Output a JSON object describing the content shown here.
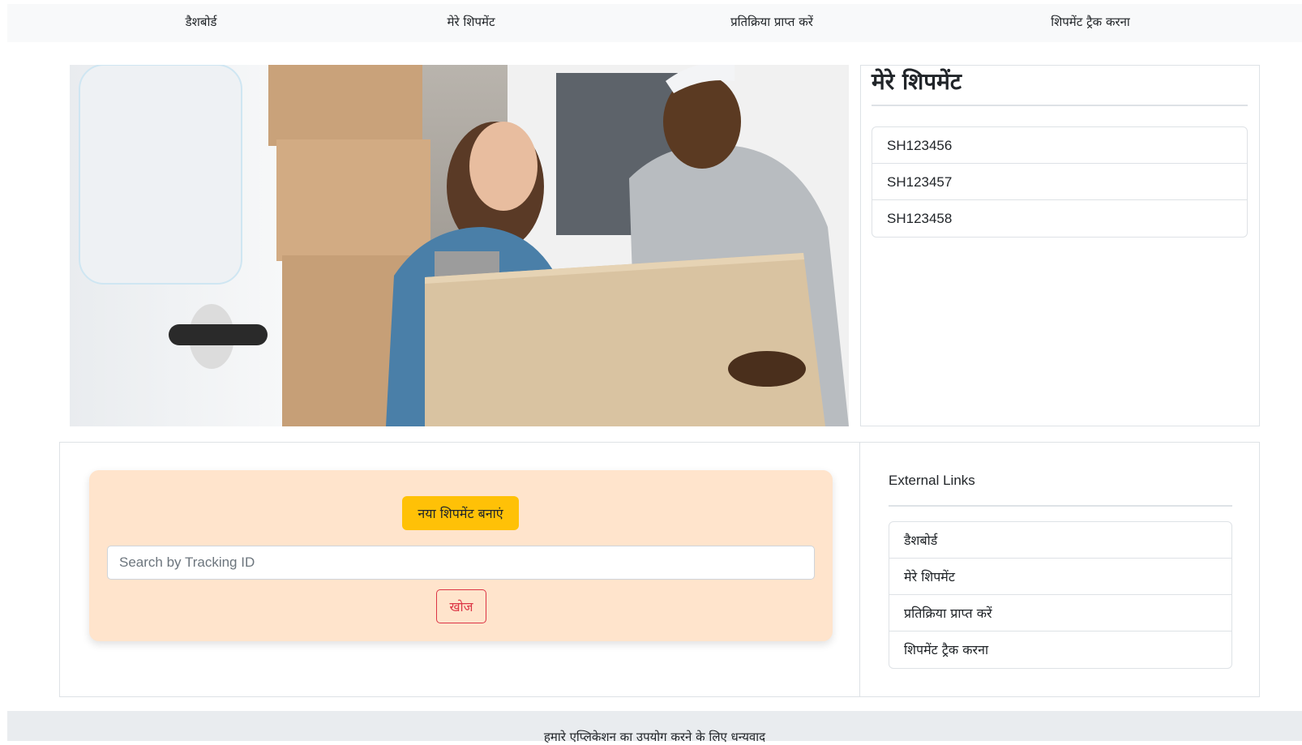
{
  "nav": {
    "items": [
      {
        "label": "डैशबोर्ड"
      },
      {
        "label": "मेरे शिपमेंट"
      },
      {
        "label": "प्रतिक्रिया प्राप्त करें"
      },
      {
        "label": "शिपमेंट ट्रैक करना"
      }
    ]
  },
  "hero": {
    "image": "delivery-photo-woman-signing-for-package-from-courier"
  },
  "my_shipments": {
    "title": "मेरे शिपमेंट",
    "items": [
      "SH123456",
      "SH123457",
      "SH123458"
    ]
  },
  "create": {
    "button_label": "नया शिपमेंट बनाएं",
    "button_color": "#ffc107",
    "card_color": "#ffe4cc"
  },
  "search": {
    "placeholder": "Search by Tracking ID",
    "value": "",
    "button_label": "खोज",
    "button_color": "#dc3545"
  },
  "external_links": {
    "title": "External Links",
    "items": [
      {
        "label": "डैशबोर्ड"
      },
      {
        "label": "मेरे शिपमेंट"
      },
      {
        "label": "प्रतिक्रिया प्राप्त करें"
      },
      {
        "label": "शिपमेंट ट्रैक करना"
      }
    ]
  },
  "footer": {
    "text": "हमारे एप्लिकेशन का उपयोग करने के लिए धन्यवाद"
  }
}
